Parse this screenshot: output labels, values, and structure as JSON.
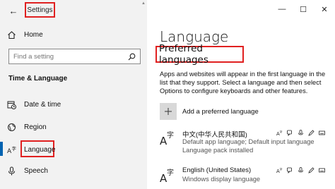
{
  "window": {
    "title": "Settings",
    "controls": {
      "minimize": "—",
      "maximize": "☐",
      "close": "✕"
    }
  },
  "sidebar": {
    "home_label": "Home",
    "search": {
      "placeholder": "Find a setting"
    },
    "section_heading": "Time & Language",
    "items": [
      {
        "label": "Date & time",
        "icon": "calendar-clock-icon"
      },
      {
        "label": "Region",
        "icon": "globe-icon"
      },
      {
        "label": "Language",
        "icon": "language-icon",
        "active": true
      },
      {
        "label": "Speech",
        "icon": "microphone-icon"
      }
    ]
  },
  "main": {
    "title": "Language",
    "preferred_heading": "Preferred languages",
    "description": "Apps and websites will appear in the first language in the list that they support. Select a language and then select Options to configure keyboards and other features.",
    "add_language_label": "Add a preferred language",
    "languages": [
      {
        "name": "中文(中华人民共和国)",
        "details": [
          "Default app language; Default input language",
          "Language pack installed"
        ]
      },
      {
        "name": "English (United States)",
        "details": [
          "Windows display language"
        ]
      }
    ]
  },
  "colors": {
    "highlight": "#e02020",
    "accent": "#0063b1",
    "sidebar_bg": "#f2f2f2"
  }
}
